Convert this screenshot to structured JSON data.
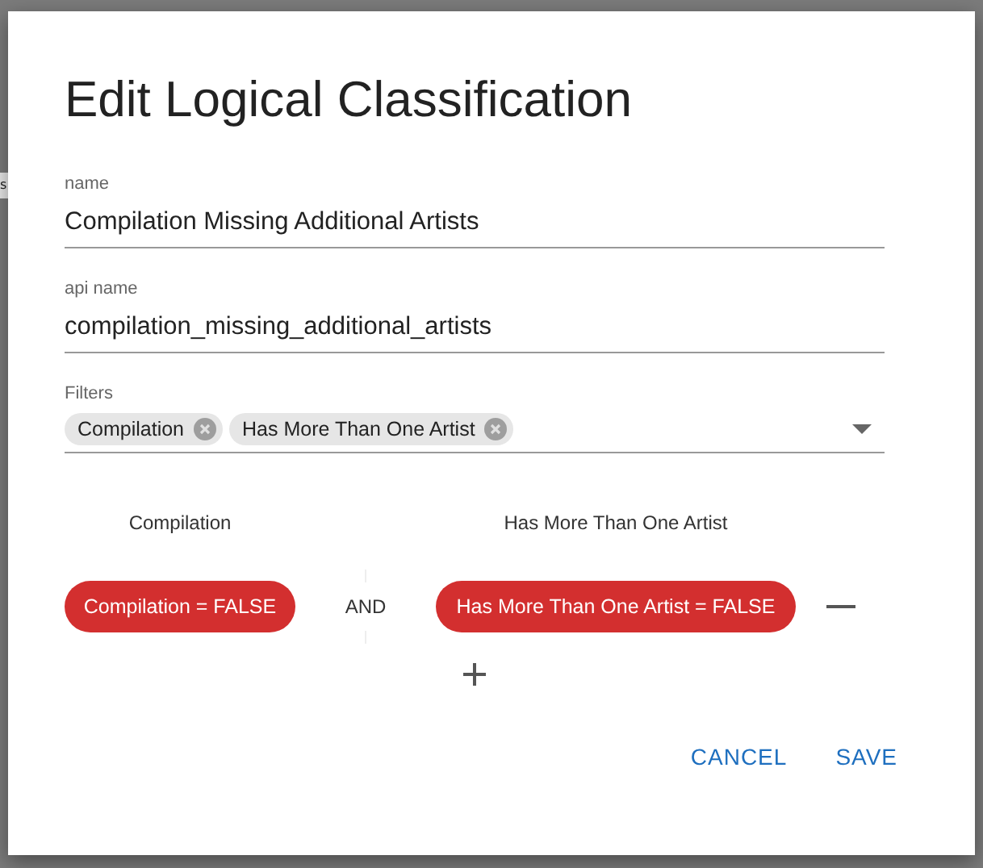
{
  "background_text": "s",
  "dialog": {
    "title": "Edit Logical Classification",
    "fields": [
      {
        "label": "name",
        "value": "Compilation Missing Additional Artists"
      },
      {
        "label": "api name",
        "value": "compilation_missing_additional_artists"
      }
    ],
    "filters": {
      "label": "Filters",
      "chips": [
        "Compilation",
        "Has More Than One Artist"
      ]
    },
    "conditions": {
      "operator": "AND",
      "groups": [
        {
          "heading": "Compilation",
          "term": "Compilation = FALSE"
        },
        {
          "heading": "Has More Than One Artist",
          "term": "Has More Than One Artist = FALSE"
        }
      ]
    },
    "buttons": [
      "CANCEL",
      "SAVE"
    ]
  }
}
